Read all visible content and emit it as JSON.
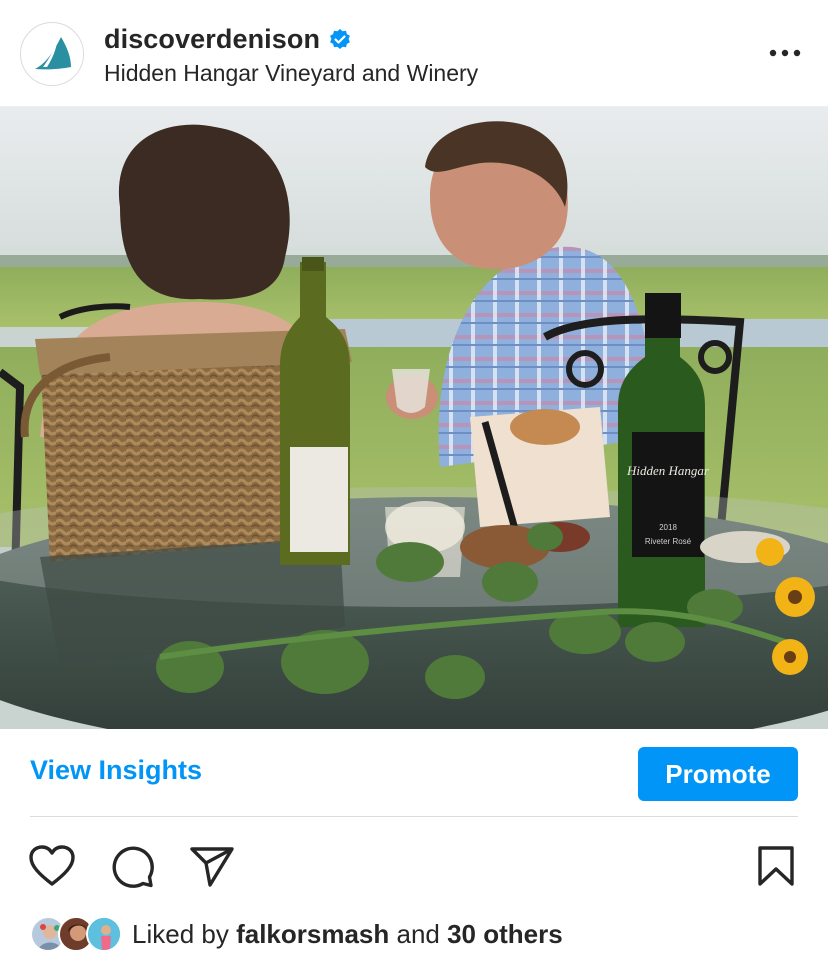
{
  "post": {
    "username": "discoverdenison",
    "location": "Hidden Hangar Vineyard and Winery",
    "verified": true
  },
  "icons": {
    "verified": "verified-badge-icon",
    "more": "more-options-icon",
    "like": "heart-icon",
    "comment": "comment-icon",
    "share": "send-icon",
    "save": "bookmark-icon"
  },
  "insights": {
    "view_label": "View Insights",
    "promote_label": "Promote"
  },
  "likes": {
    "prefix": "Liked by ",
    "first_user": "falkorsmash",
    "middle": " and ",
    "others": "30 others"
  },
  "bottle_labels": {
    "right_brand": "Hidden Hangar",
    "right_year": "2018",
    "right_wine": "Riveter Rosé"
  },
  "colors": {
    "accent": "#0095f6",
    "text": "#262626",
    "divider": "#dbdbdb"
  }
}
